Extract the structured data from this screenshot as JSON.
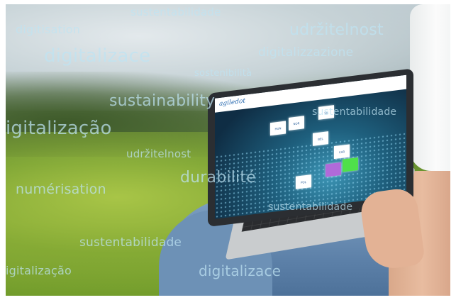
{
  "overlay_words": [
    {
      "text": "sustentabilidade"
    },
    {
      "text": "digitisation"
    },
    {
      "text": "udržitelnost"
    },
    {
      "text": "digitalizace"
    },
    {
      "text": "digitalizzazione"
    },
    {
      "text": "sostenibilità"
    },
    {
      "text": "sustainability"
    },
    {
      "text": "sustentabilidade"
    },
    {
      "text": "igitalização"
    },
    {
      "text": "udržitelnost"
    },
    {
      "text": "durabilité"
    },
    {
      "text": "numérisation"
    },
    {
      "text": "sustentabilidade"
    },
    {
      "text": "sustentabilidade"
    },
    {
      "text": "igitalização"
    },
    {
      "text": "digitalizace"
    }
  ],
  "laptop": {
    "logo_text": "agiledot",
    "tiles": [
      {
        "label": "HUN",
        "color": "#ffffff"
      },
      {
        "label": "NOR",
        "color": "#ffffff"
      },
      {
        "label": "SK",
        "color": "#ffffff"
      },
      {
        "label": "BEL",
        "color": "#ffffff"
      },
      {
        "label": "CAR",
        "color": "#ffffff"
      },
      {
        "label": "POL",
        "color": "#ffffff"
      },
      {
        "label": "",
        "color": "#b06ad9"
      },
      {
        "label": "",
        "color": "#4fe04a"
      }
    ]
  }
}
